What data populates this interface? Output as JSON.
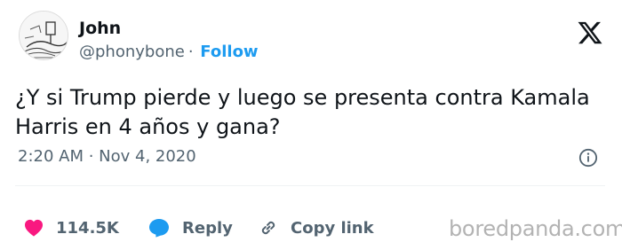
{
  "author": {
    "name": "John",
    "handle": "@phonybone",
    "separator": "·",
    "follow_label": "Follow"
  },
  "tweet": {
    "text": "¿Y si Trump pierde y luego se presenta contra Kamala Harris en 4 años y gana?",
    "timestamp": "2:20 AM · Nov 4, 2020"
  },
  "actions": {
    "likes": "114.5K",
    "reply_label": "Reply",
    "copy_link_label": "Copy link"
  },
  "watermark": "boredpanda.com",
  "colors": {
    "accent": "#1d9bf0",
    "like": "#f91880",
    "text": "#0f1419",
    "secondary": "#536471"
  },
  "icons": [
    "x-logo-icon",
    "info-icon",
    "heart-icon",
    "reply-icon",
    "link-icon"
  ]
}
